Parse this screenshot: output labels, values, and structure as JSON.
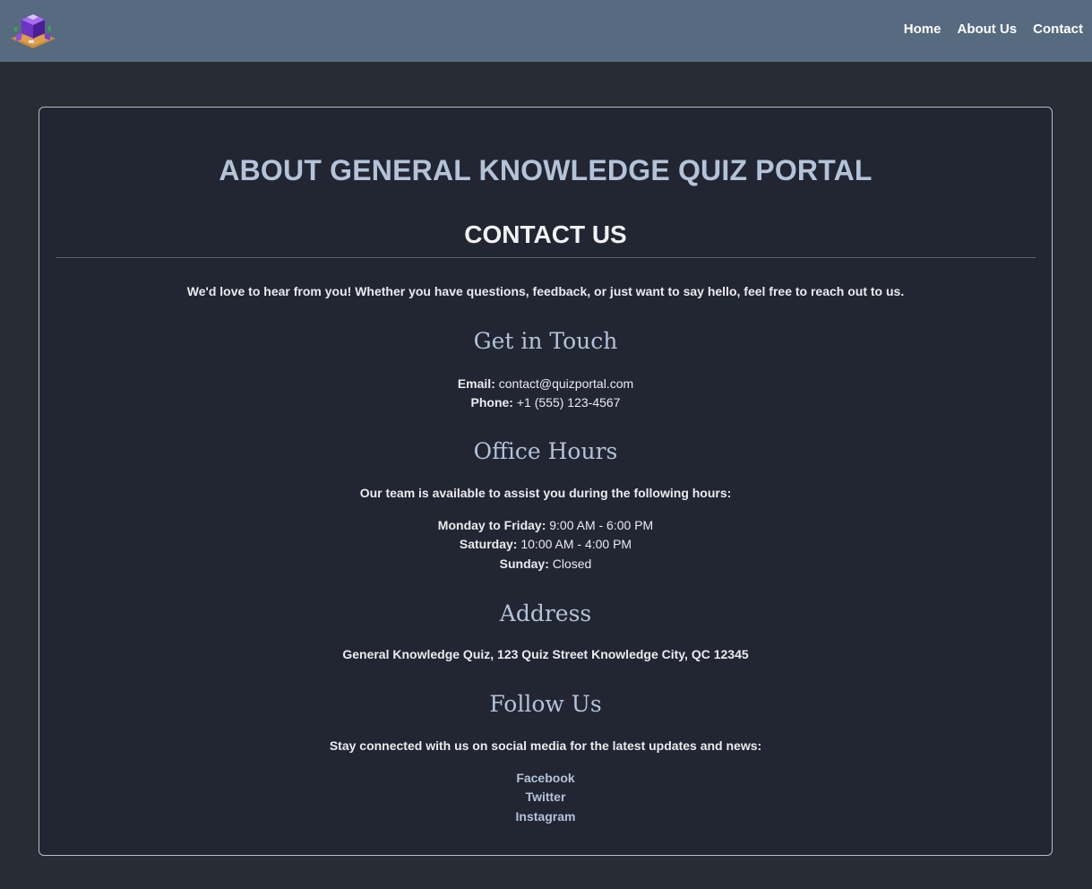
{
  "nav": {
    "logo_icon": "purple-crystal-cube-logo-icon",
    "links": [
      "Home",
      "About Us",
      "Contact"
    ]
  },
  "page": {
    "title": "ABOUT GENERAL KNOWLEDGE QUIZ PORTAL",
    "contact_heading": "CONTACT US",
    "intro": "We'd love to hear from you! Whether you have questions, feedback, or just want to say hello, feel free to reach out to us."
  },
  "get_in_touch": {
    "heading": "Get in Touch",
    "email_label": "Email:",
    "email_value": "contact@quizportal.com",
    "phone_label": "Phone:",
    "phone_value": "+1 (555) 123-4567"
  },
  "office_hours": {
    "heading": "Office Hours",
    "intro": "Our team is available to assist you during the following hours:",
    "rows": [
      {
        "label": "Monday to Friday:",
        "value": "9:00 AM - 6:00 PM"
      },
      {
        "label": "Saturday:",
        "value": "10:00 AM - 4:00 PM"
      },
      {
        "label": "Sunday:",
        "value": "Closed"
      }
    ]
  },
  "address": {
    "heading": "Address",
    "text": "General Knowledge Quiz, 123 Quiz Street Knowledge City, QC 12345"
  },
  "follow_us": {
    "heading": "Follow Us",
    "intro": "Stay connected with us on social media for the latest updates and news:",
    "links": [
      "Facebook",
      "Twitter",
      "Instagram"
    ]
  },
  "colors": {
    "navbar_bg": "#566a80",
    "page_bg": "#282c35",
    "card_bg": "#222532",
    "accent_heading": "#b3c3d8",
    "text": "#ebebef"
  }
}
